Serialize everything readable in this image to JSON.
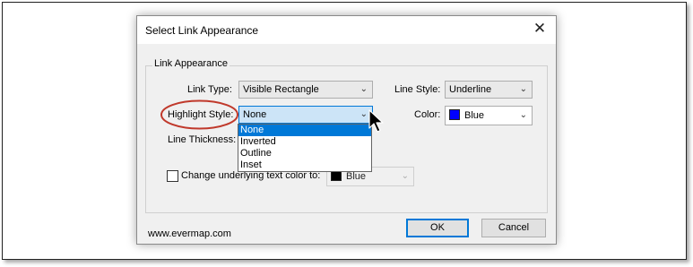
{
  "dialog": {
    "title": "Select Link Appearance",
    "close_glyph": "✕",
    "group_title": "Link Appearance",
    "link_type": {
      "label": "Link Type:",
      "value": "Visible Rectangle"
    },
    "line_style": {
      "label": "Line Style:",
      "value": "Underline"
    },
    "highlight_style": {
      "label": "Highlight Style:",
      "value": "None",
      "options": [
        "None",
        "Inverted",
        "Outline",
        "Inset"
      ],
      "selected_index": 0
    },
    "color": {
      "label": "Color:",
      "value": "Blue",
      "swatch": "#0000ff"
    },
    "line_thickness": {
      "label": "Line Thickness:"
    },
    "change_text_color": {
      "label": "Change underlying text color to:",
      "checked": false,
      "value": "Blue",
      "swatch": "#000000"
    },
    "ok_label": "OK",
    "cancel_label": "Cancel",
    "footer": "www.evermap.com"
  },
  "colors": {
    "accent": "#0078d7",
    "highlight_circle": "#c0392b"
  },
  "icons": {
    "chevron": "chevron-down-icon",
    "cursor": "mouse-pointer-icon"
  }
}
